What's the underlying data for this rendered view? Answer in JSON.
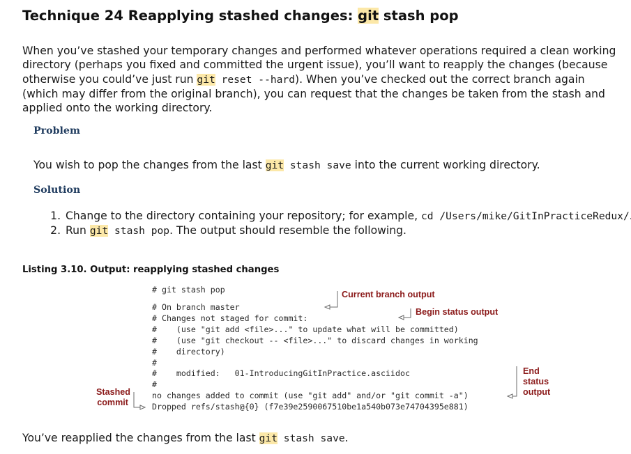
{
  "title": {
    "prefix": "Technique 24 Reapplying stashed changes: ",
    "code": "git",
    "suffix": " stash pop"
  },
  "intro": {
    "part1": "When you’ve stashed your temporary changes and performed whatever operations required a clean working directory (perhaps you fixed and committed the urgent issue), you’ll want to reapply the changes (because otherwise you could’ve just run ",
    "code_git": "git",
    "code_rest": " reset --hard",
    "part2": "). When you’ve checked out the correct branch again (which may differ from the original branch), you can request that the changes be taken from the stash and applied onto the working directory."
  },
  "problem": {
    "heading": "Problem",
    "text_before": "You wish to pop the changes from the last ",
    "code_git": "git",
    "code_rest": " stash save",
    "text_after": " into the current working directory."
  },
  "solution": {
    "heading": "Solution",
    "step1_text": "Change to the directory containing your repository; for example, ",
    "step1_code": "cd /Users/mike/GitInPracticeRedux/",
    "step1_end": ".",
    "step2_before": "Run ",
    "step2_code_git": "git",
    "step2_code_rest": " stash pop",
    "step2_after": ". The output should resemble the following."
  },
  "listing": {
    "caption": "Listing 3.10. Output: reapplying stashed changes",
    "lines": [
      "# git stash pop",
      "",
      "# On branch master",
      "# Changes not staged for commit:",
      "#    (use \"git add <file>...\" to update what will be committed)",
      "#    (use \"git checkout -- <file>...\" to discard changes in working",
      "#    directory)",
      "#",
      "#    modified:   01-IntroducingGitInPractice.asciidoc",
      "#",
      "no changes added to commit (use \"git add\" and/or \"git commit -a\")",
      "Dropped refs/stash@{0} (f7e39e2590067510be1a540b073e74704395e881)"
    ],
    "annotations": {
      "current_branch": "Current branch output",
      "begin_status": "Begin status output",
      "end_status": "End\nstatus\noutput",
      "stashed_commit": "Stashed\ncommit"
    }
  },
  "closing": {
    "before": "You’ve reapplied the changes from the last ",
    "code_git": "git",
    "code_rest": " stash save",
    "after": "."
  },
  "colors": {
    "highlight": "#fce8a8",
    "heading": "#1f3b5e",
    "annotation": "#8b1a1a"
  }
}
